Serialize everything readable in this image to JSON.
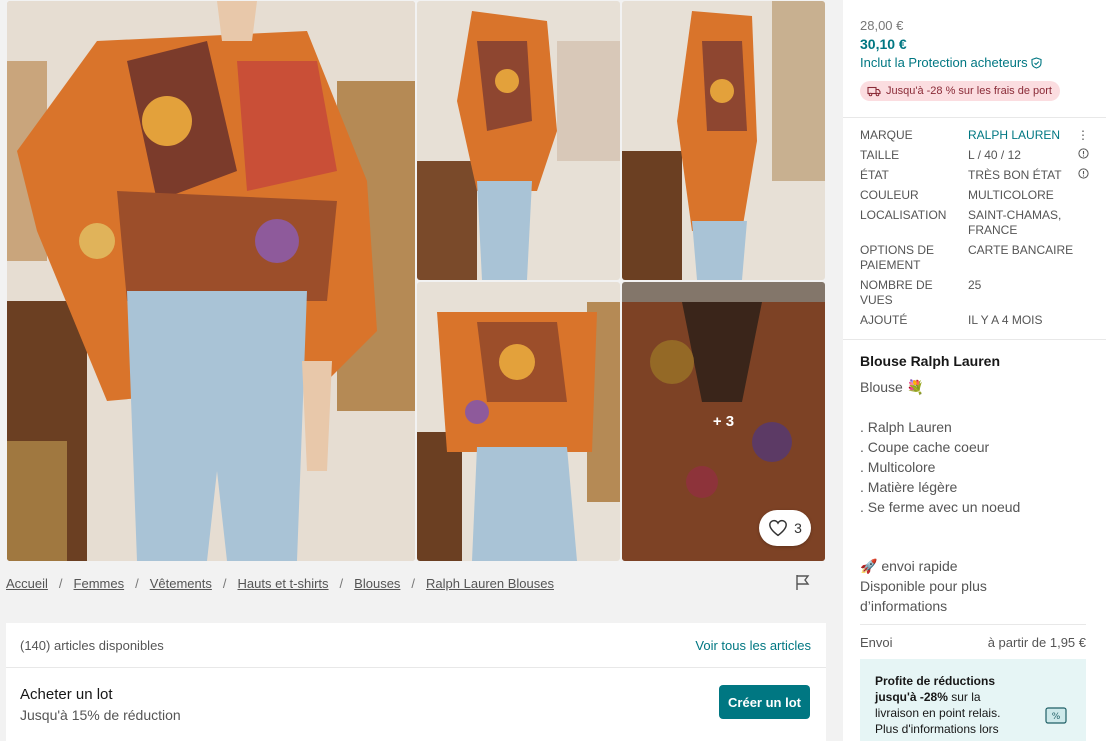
{
  "gallery": {
    "extra_photos": "+ 3",
    "favourites_count": "3"
  },
  "breadcrumb": [
    "Accueil",
    "Femmes",
    "Vêtements",
    "Hauts et t-shirts",
    "Blouses",
    "Ralph Lauren Blouses"
  ],
  "bundle": {
    "articles_available": "(140) articles disponibles",
    "see_all": "Voir tous les articles",
    "title": "Acheter un lot",
    "subtitle": "Jusqu'à 15% de réduction",
    "button": "Créer un lot"
  },
  "pricing": {
    "old_price": "28,00 €",
    "price": "30,10 €",
    "protection": "Inclut la Protection acheteurs",
    "shipping_discount": "Jusqu'à -28 % sur les frais de port"
  },
  "details": [
    {
      "label": "Marque",
      "value": "RALPH LAUREN",
      "icon": "more-icon"
    },
    {
      "label": "Taille",
      "value": "L / 40 / 12",
      "icon": "info-icon"
    },
    {
      "label": "État",
      "value": "TRÈS BON ÉTAT",
      "icon": "info-icon"
    },
    {
      "label": "Couleur",
      "value": "MULTICOLORE",
      "icon": ""
    },
    {
      "label": "Localisation",
      "value": "SAINT-CHAMAS, FRANCE",
      "icon": ""
    },
    {
      "label": "Options de paiement",
      "value": "CARTE BANCAIRE",
      "icon": ""
    },
    {
      "label": "Nombre de vues",
      "value": "25",
      "icon": ""
    },
    {
      "label": "Ajouté",
      "value": "IL Y A 4 MOIS",
      "icon": ""
    }
  ],
  "description": {
    "title": "Blouse Ralph Lauren",
    "intro": "Blouse 💐",
    "bullets": [
      ". Ralph Lauren",
      ". Coupe cache coeur",
      ". Multicolore",
      ". Matière légère",
      ". Se ferme avec un noeud"
    ],
    "footer": [
      "🚀 envoi rapide",
      "Disponible pour plus",
      "d’informations"
    ]
  },
  "shipping": {
    "label": "Envoi",
    "value": "à partir de 1,95 €"
  },
  "promo": {
    "text_bold": "Profite de réductions jusqu'à -28%",
    "text_rest": " sur la livraison en point relais. Plus d'informations lors"
  },
  "colors": {
    "accent": "#007782",
    "badge_bg": "#fbdde0",
    "promo_bg": "#e6f5f5"
  }
}
